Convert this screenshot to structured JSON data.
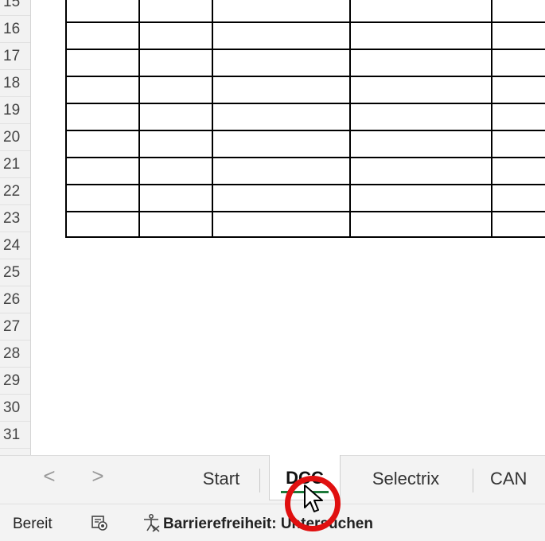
{
  "sheet": {
    "row_numbers": [
      "15",
      "16",
      "17",
      "18",
      "19",
      "20",
      "21",
      "22",
      "23",
      "24",
      "25",
      "26",
      "27",
      "28",
      "29",
      "30",
      "31"
    ]
  },
  "tabs": {
    "prev_arrow": "<",
    "next_arrow": ">",
    "items": [
      {
        "label": "Start"
      },
      {
        "label": "DCC"
      },
      {
        "label": "Selectrix"
      },
      {
        "label": "CAN"
      }
    ],
    "active_tab": "DCC"
  },
  "status": {
    "ready": "Bereit",
    "accessibility": "Barrierefreiheit: Untersuchen"
  },
  "colors": {
    "active_tab_underline": "#1d7a3a",
    "click_highlight": "#e01010"
  },
  "icons": [
    "macro-record-icon",
    "accessibility-icon",
    "mouse-pointer-icon"
  ]
}
